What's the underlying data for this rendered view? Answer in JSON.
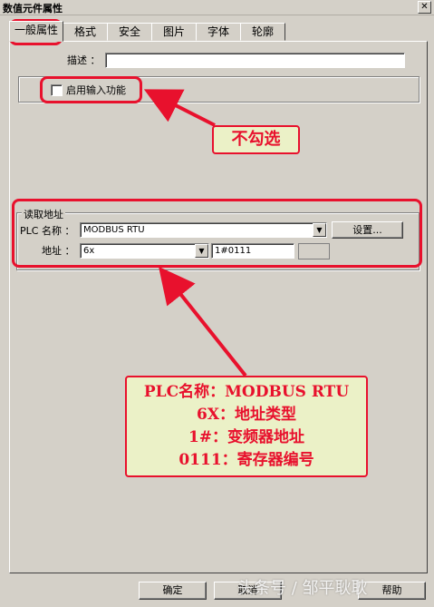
{
  "window": {
    "title": "数值元件属性",
    "close_glyph": "✕"
  },
  "tabs": [
    "一般属性",
    "格式",
    "安全",
    "图片",
    "字体",
    "轮廓"
  ],
  "description": {
    "label": "描述 ：",
    "value": ""
  },
  "input_feature": {
    "label": "启用输入功能",
    "checked": false
  },
  "read_address": {
    "group_label": "读取地址",
    "plc_label": "PLC 名称 ：",
    "plc_value": "MODBUS RTU",
    "settings_button": "设置...",
    "address_label": "地址 ：",
    "address_type": "6x",
    "address_value": "1#0111"
  },
  "footer": {
    "ok": "确定",
    "cancel": "取消",
    "help": "帮助"
  },
  "annotations": {
    "callout_uncheck": "不勾选",
    "callout_lines": [
      "PLC名称：MODBUS RTU",
      "6X：地址类型",
      "1#：变频器地址",
      "0111：寄存器编号"
    ],
    "color": "#e8112d",
    "callout_bg": "#ebf1c7"
  },
  "watermark": "头条号 / 邹平耿耿"
}
